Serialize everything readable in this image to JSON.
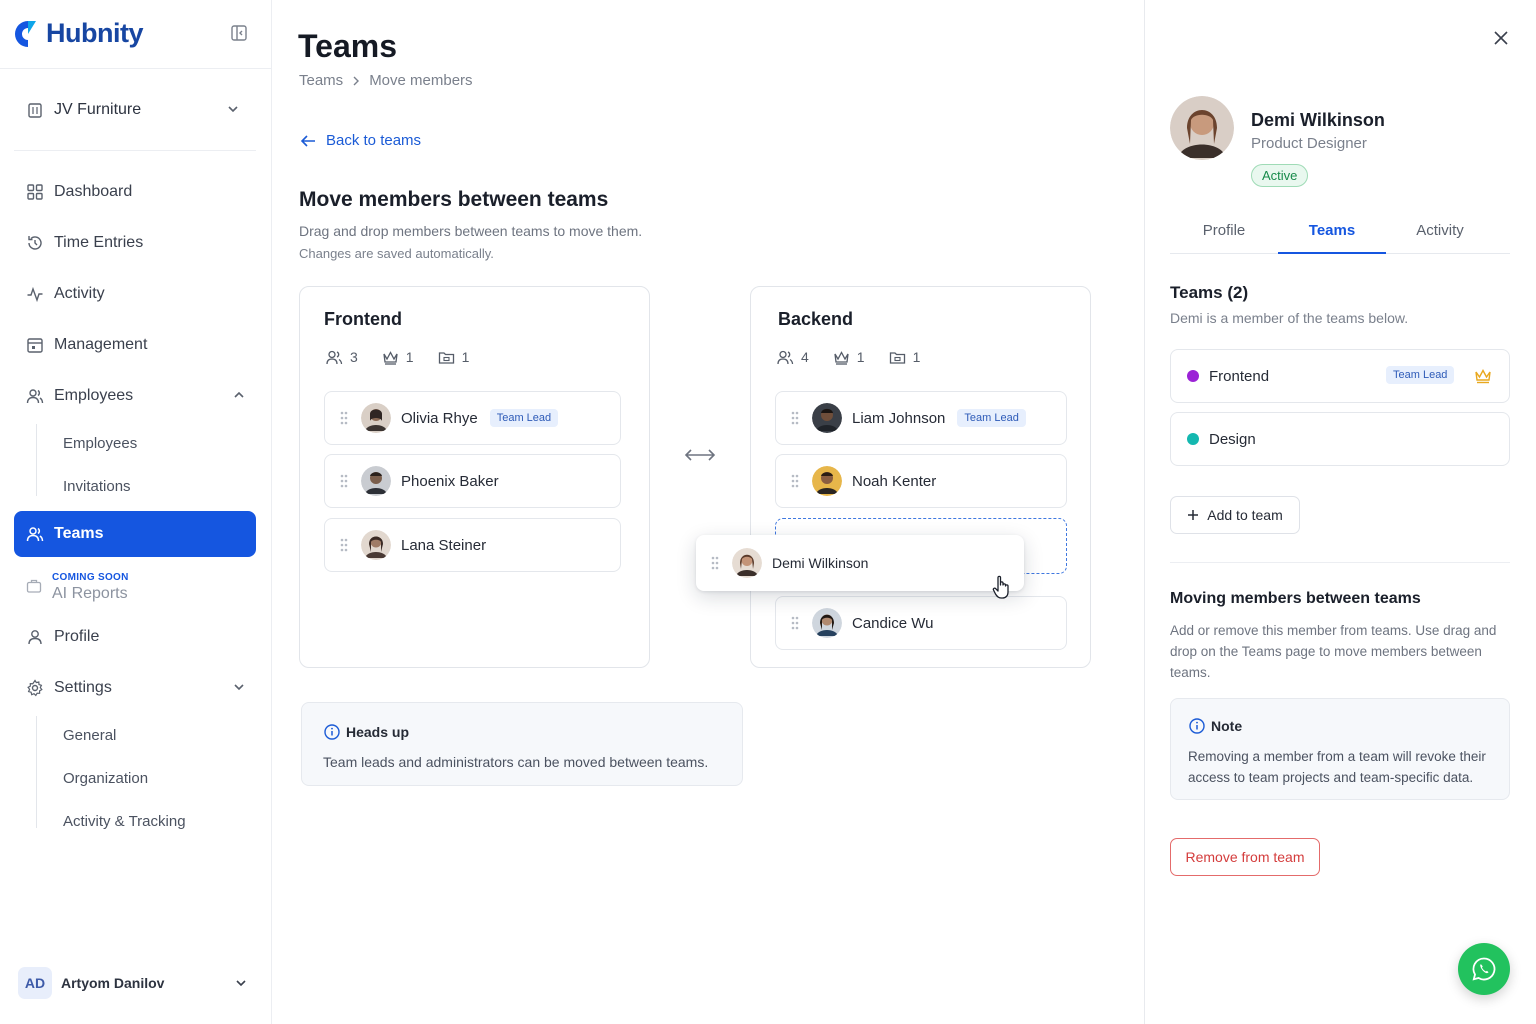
{
  "brand": {
    "name": "Hubnity",
    "accent": "#1556e0"
  },
  "sidebar": {
    "org": "JV Furniture",
    "items": [
      {
        "label": "Dashboard",
        "icon": "grid-icon"
      },
      {
        "label": "Time Entries",
        "icon": "history-icon"
      },
      {
        "label": "Activity",
        "icon": "activity-icon"
      },
      {
        "label": "Management",
        "icon": "calendar-icon"
      },
      {
        "label": "Employees",
        "icon": "users-icon"
      },
      {
        "label": "Teams",
        "icon": "users-icon"
      },
      {
        "label": "Profile",
        "icon": "user-icon"
      },
      {
        "label": "Settings",
        "icon": "gear-icon"
      }
    ],
    "employees_sub": [
      "Employees",
      "Invitations"
    ],
    "ai_reports": {
      "badge": "COMING SOON",
      "label": "AI Reports"
    },
    "settings_sub": [
      "General",
      "Organization",
      "Activity & Tracking"
    ],
    "user": {
      "initials": "AD",
      "name": "Artyom Danilov"
    }
  },
  "main": {
    "title": "Teams",
    "breadcrumb": [
      "Teams",
      "Move members"
    ],
    "back_label": "Back to teams",
    "section_title": "Move members between teams",
    "section_desc": "Drag and drop members between teams to move them.",
    "section_desc2": "Changes are saved automatically.",
    "teams": [
      {
        "name": "Frontend",
        "stats": {
          "members": "3",
          "leads": "1",
          "projects": "1"
        },
        "members": [
          {
            "name": "Olivia Rhye",
            "badge": "Team Lead"
          },
          {
            "name": "Phoenix Baker",
            "badge": ""
          },
          {
            "name": "Lana Steiner",
            "badge": ""
          }
        ]
      },
      {
        "name": "Backend",
        "stats": {
          "members": "4",
          "leads": "1",
          "projects": "1"
        },
        "members": [
          {
            "name": "Liam Johnson",
            "badge": "Team Lead"
          },
          {
            "name": "Noah Kenter",
            "badge": ""
          },
          {
            "name": "Candice Wu",
            "badge": ""
          }
        ]
      }
    ],
    "dragging": "Demi Wilkinson",
    "heads_up": {
      "title": "Heads up",
      "body": "Team leads and administrators can be moved between teams."
    }
  },
  "panel": {
    "name": "Demi Wilkinson",
    "role": "Product Designer",
    "status": "Active",
    "tabs": [
      "Profile",
      "Teams",
      "Activity"
    ],
    "active_tab": "Teams",
    "teams_heading": "Teams (2)",
    "teams_sub": "Demi is a member of the teams below.",
    "teams": [
      {
        "name": "Frontend",
        "color": "#9b22d6",
        "badge": "Team Lead"
      },
      {
        "name": "Design",
        "color": "#14b8b0",
        "badge": ""
      }
    ],
    "add_label": "Add to team",
    "moving_title": "Moving members between teams",
    "moving_body": "Add or remove this member from teams. Use drag and drop on the Teams page to move members between teams.",
    "note_title": "Note",
    "note_body": "Removing a member from a team will revoke their access to team projects and team-specific data.",
    "remove_label": "Remove from team"
  }
}
